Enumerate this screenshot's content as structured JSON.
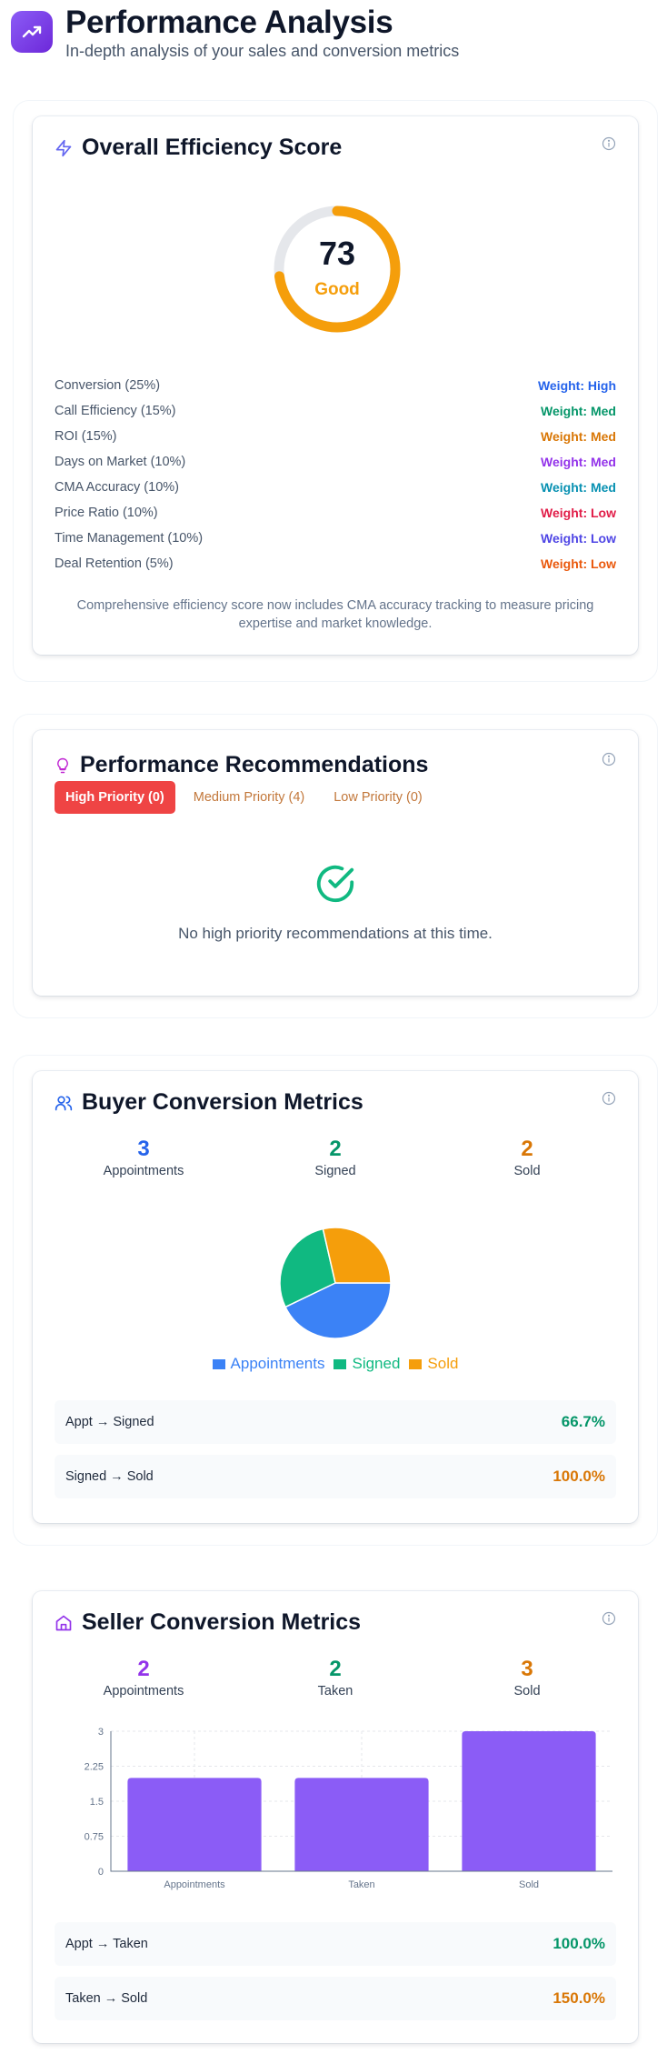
{
  "header": {
    "title": "Performance Analysis",
    "subtitle": "In-depth analysis of your sales and conversion metrics"
  },
  "efficiency": {
    "title": "Overall Efficiency Score",
    "score": "73",
    "score_value": 73,
    "rating": "Good",
    "factors": [
      {
        "name": "Conversion (25%)",
        "weight": "Weight: High",
        "color": "#2563eb"
      },
      {
        "name": "Call Efficiency (15%)",
        "weight": "Weight: Med",
        "color": "#059669"
      },
      {
        "name": "ROI (15%)",
        "weight": "Weight: Med",
        "color": "#d97706"
      },
      {
        "name": "Days on Market (10%)",
        "weight": "Weight: Med",
        "color": "#9333ea"
      },
      {
        "name": "CMA Accuracy (10%)",
        "weight": "Weight: Med",
        "color": "#0891b2"
      },
      {
        "name": "Price Ratio (10%)",
        "weight": "Weight: Low",
        "color": "#e11d48"
      },
      {
        "name": "Time Management (10%)",
        "weight": "Weight: Low",
        "color": "#4f46e5"
      },
      {
        "name": "Deal Retention (5%)",
        "weight": "Weight: Low",
        "color": "#ea580c"
      }
    ],
    "note": "Comprehensive efficiency score now includes CMA accuracy tracking to measure pricing expertise and market knowledge."
  },
  "recommendations": {
    "title": "Performance Recommendations",
    "tabs": {
      "high": "High Priority (0)",
      "medium": "Medium Priority (4)",
      "low": "Low Priority (0)"
    },
    "empty_message": "No high priority recommendations at this time."
  },
  "buyer": {
    "title": "Buyer Conversion Metrics",
    "stats": [
      {
        "value": "3",
        "label": "Appointments",
        "color": "#2563eb"
      },
      {
        "value": "2",
        "label": "Signed",
        "color": "#059669"
      },
      {
        "value": "2",
        "label": "Sold",
        "color": "#d97706"
      }
    ],
    "legend": [
      "Appointments",
      "Signed",
      "Sold"
    ],
    "rates": [
      {
        "label": "Appt → Signed",
        "value": "66.7%",
        "color": "#059669"
      },
      {
        "label": "Signed → Sold",
        "value": "100.0%",
        "color": "#d97706"
      }
    ]
  },
  "seller": {
    "title": "Seller Conversion Metrics",
    "stats": [
      {
        "value": "2",
        "label": "Appointments",
        "color": "#9333ea"
      },
      {
        "value": "2",
        "label": "Taken",
        "color": "#059669"
      },
      {
        "value": "3",
        "label": "Sold",
        "color": "#d97706"
      }
    ],
    "rates": [
      {
        "label": "Appt → Taken",
        "value": "100.0%",
        "color": "#059669"
      },
      {
        "label": "Taken → Sold",
        "value": "150.0%",
        "color": "#d97706"
      }
    ]
  },
  "chart_data": [
    {
      "type": "pie",
      "categories": [
        "Appointments",
        "Signed",
        "Sold"
      ],
      "values": [
        3,
        2,
        2
      ],
      "colors": [
        "#3b82f6",
        "#10b981",
        "#f59e0b"
      ],
      "legend": "bottom"
    },
    {
      "type": "bar",
      "categories": [
        "Appointments",
        "Taken",
        "Sold"
      ],
      "values": [
        2,
        2,
        3
      ],
      "ylim": [
        0,
        3
      ],
      "yticks": [
        "0",
        "0.75",
        "1.5",
        "2.25",
        "3"
      ],
      "grid": true,
      "color": "#8b5cf6"
    }
  ]
}
